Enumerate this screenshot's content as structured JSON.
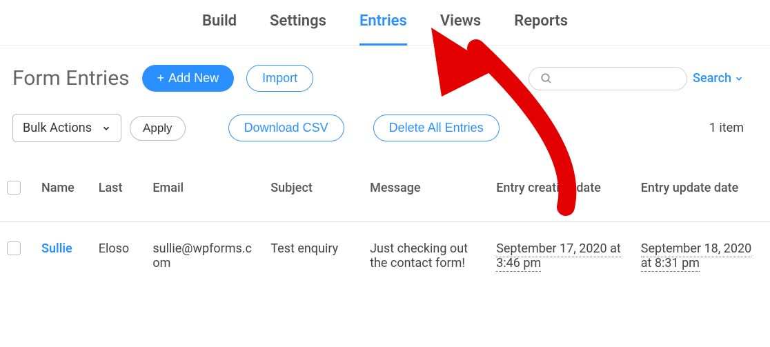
{
  "tabs": {
    "build": "Build",
    "settings": "Settings",
    "entries": "Entries",
    "views": "Views",
    "reports": "Reports"
  },
  "page": {
    "title": "Form Entries"
  },
  "buttons": {
    "add_new": "Add New",
    "import": "Import",
    "download_csv": "Download CSV",
    "delete_all": "Delete All Entries",
    "apply": "Apply"
  },
  "search": {
    "label": "Search"
  },
  "bulk": {
    "label": "Bulk Actions"
  },
  "item_count": "1 item",
  "columns": {
    "name": "Name",
    "last": "Last",
    "email": "Email",
    "subject": "Subject",
    "message": "Message",
    "creation": "Entry creation date",
    "update": "Entry update date"
  },
  "rows": [
    {
      "name": "Sullie",
      "last": "Eloso",
      "email": "sullie@wpforms.com",
      "subject": "Test enquiry",
      "message": "Just checking out the contact form!",
      "creation": "September 17, 2020 at 3:46 pm",
      "update": "September 18, 2020 at 8:31 pm"
    }
  ]
}
